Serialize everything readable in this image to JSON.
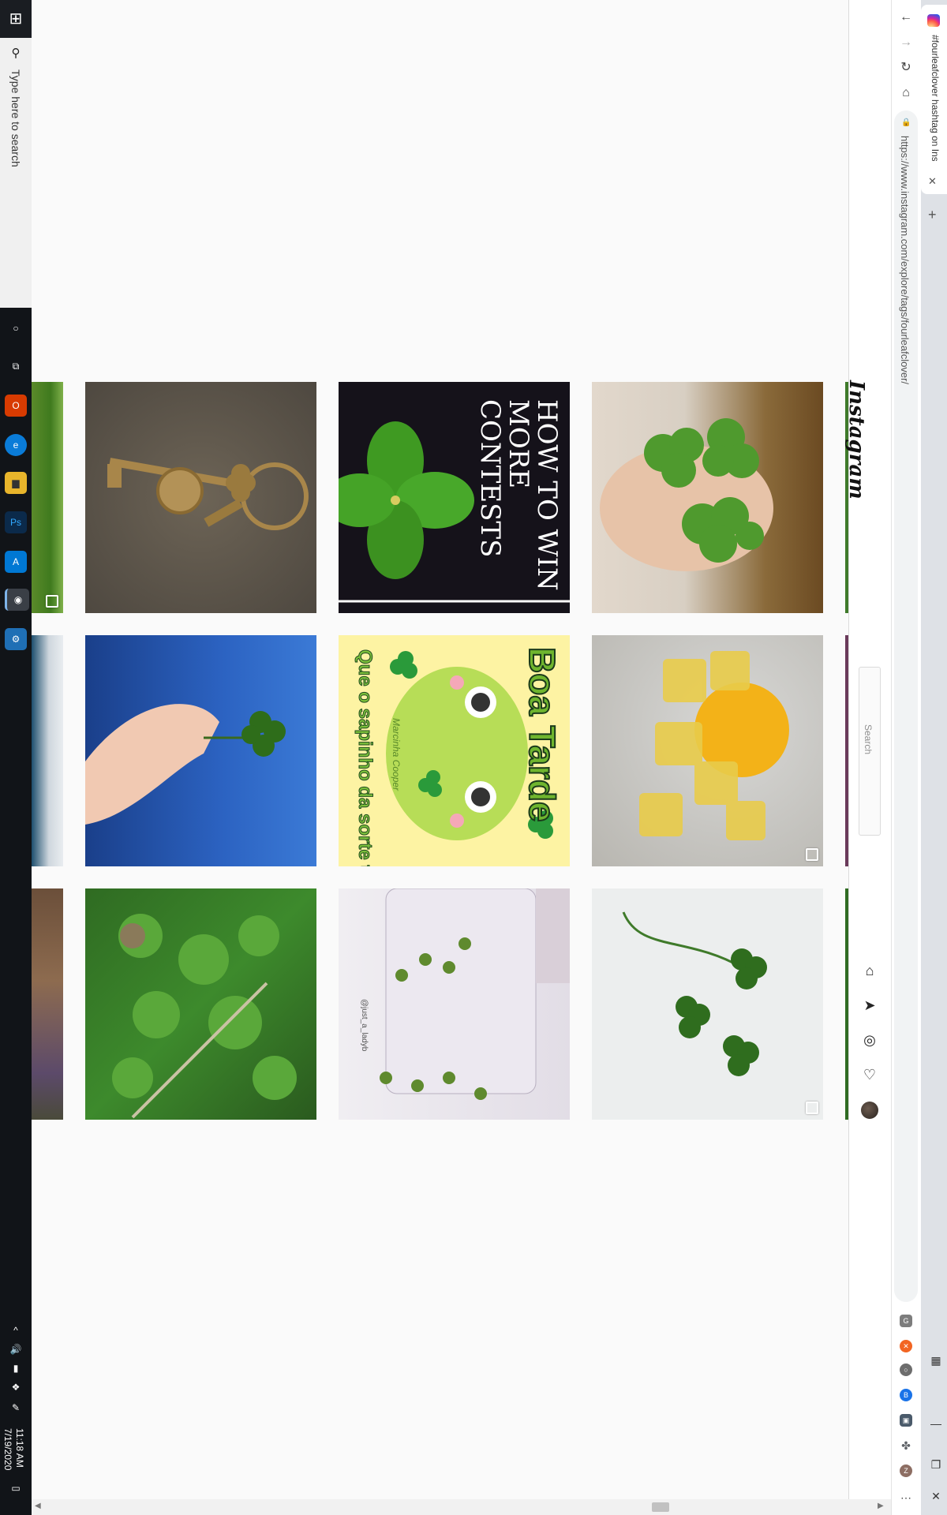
{
  "taskbar": {
    "start_label": "⊞",
    "search_placeholder": "Type here to search",
    "apps": [
      {
        "name": "cortana",
        "glyph": "○"
      },
      {
        "name": "task-view",
        "glyph": "⧉"
      },
      {
        "name": "office",
        "glyph": "O"
      },
      {
        "name": "edge",
        "glyph": "e"
      },
      {
        "name": "file-explorer",
        "glyph": "▆"
      },
      {
        "name": "photoshop",
        "glyph": "Ps"
      },
      {
        "name": "azure",
        "glyph": "A"
      },
      {
        "name": "chrome",
        "glyph": "◉"
      },
      {
        "name": "settings",
        "glyph": "⚙"
      }
    ],
    "clock_time": "11:18 AM",
    "clock_date": "7/19/2020",
    "tray": [
      "^",
      "🔊",
      "▮",
      "❖",
      "✎"
    ],
    "notification_glyph": "▭"
  },
  "browser": {
    "tab_title": "#fourleafclover hashtag on Insta",
    "url": "https://www.instagram.com/explore/tags/fourleafclover/",
    "back": "←",
    "forward": "→",
    "reload": "↻",
    "home": "⌂",
    "close_tab": "✕",
    "new_tab": "+",
    "extensions": [
      {
        "name": "ext-g",
        "glyph": "G",
        "color": "#7d7d7d"
      },
      {
        "name": "ext-orange",
        "glyph": "✕",
        "color": "#f26522"
      },
      {
        "name": "ext-circle",
        "glyph": "○",
        "color": "#6d6d6d"
      },
      {
        "name": "ext-blue",
        "glyph": "B",
        "color": "#1a73e8"
      },
      {
        "name": "ext-photo",
        "glyph": "▣",
        "color": "#4a5a6a"
      },
      {
        "name": "extensions-puzzle",
        "glyph": "✤",
        "color": "#5f6368"
      },
      {
        "name": "profile",
        "glyph": "Z",
        "color": "#8d6e63"
      }
    ],
    "window_controls": {
      "layout": "▦",
      "minimize": "—",
      "restore": "❐",
      "close": "✕"
    },
    "menu": "⋯"
  },
  "instagram": {
    "logo": "Instagram",
    "search_placeholder": "Search",
    "nav_icons": [
      "home",
      "direct",
      "explore",
      "activity",
      "profile"
    ]
  },
  "grid": {
    "rows": [
      [
        {
          "name": "post-key-keychain",
          "multi": false
        },
        {
          "name": "post-how-to-win-contests",
          "multi": false,
          "caption": "HOW TO WIN MORE CONTESTS"
        },
        {
          "name": "post-clovers-in-hand",
          "multi": false
        }
      ],
      [
        {
          "name": "post-clover-blue-sky",
          "multi": false
        },
        {
          "name": "post-boa-tarde-frog",
          "multi": false,
          "caption_title": "Boa Tarde",
          "caption_sub": "Que o sapinho da sorte te acompanhe",
          "caption_sig": "Marcinha Cooper"
        },
        {
          "name": "post-lemon-jelly",
          "multi": true
        }
      ],
      [
        {
          "name": "post-clover-patch",
          "multi": false
        },
        {
          "name": "post-pressed-clovers-laminator",
          "multi": false,
          "caption": "@just_a_ladyb"
        },
        {
          "name": "post-three-clovers-white",
          "multi": true
        }
      ]
    ]
  },
  "colors": {
    "taskbar": "#111418",
    "page_bg": "#fafafa",
    "ig_border": "#dbdbdb",
    "tab_strip": "#dee1e6"
  }
}
